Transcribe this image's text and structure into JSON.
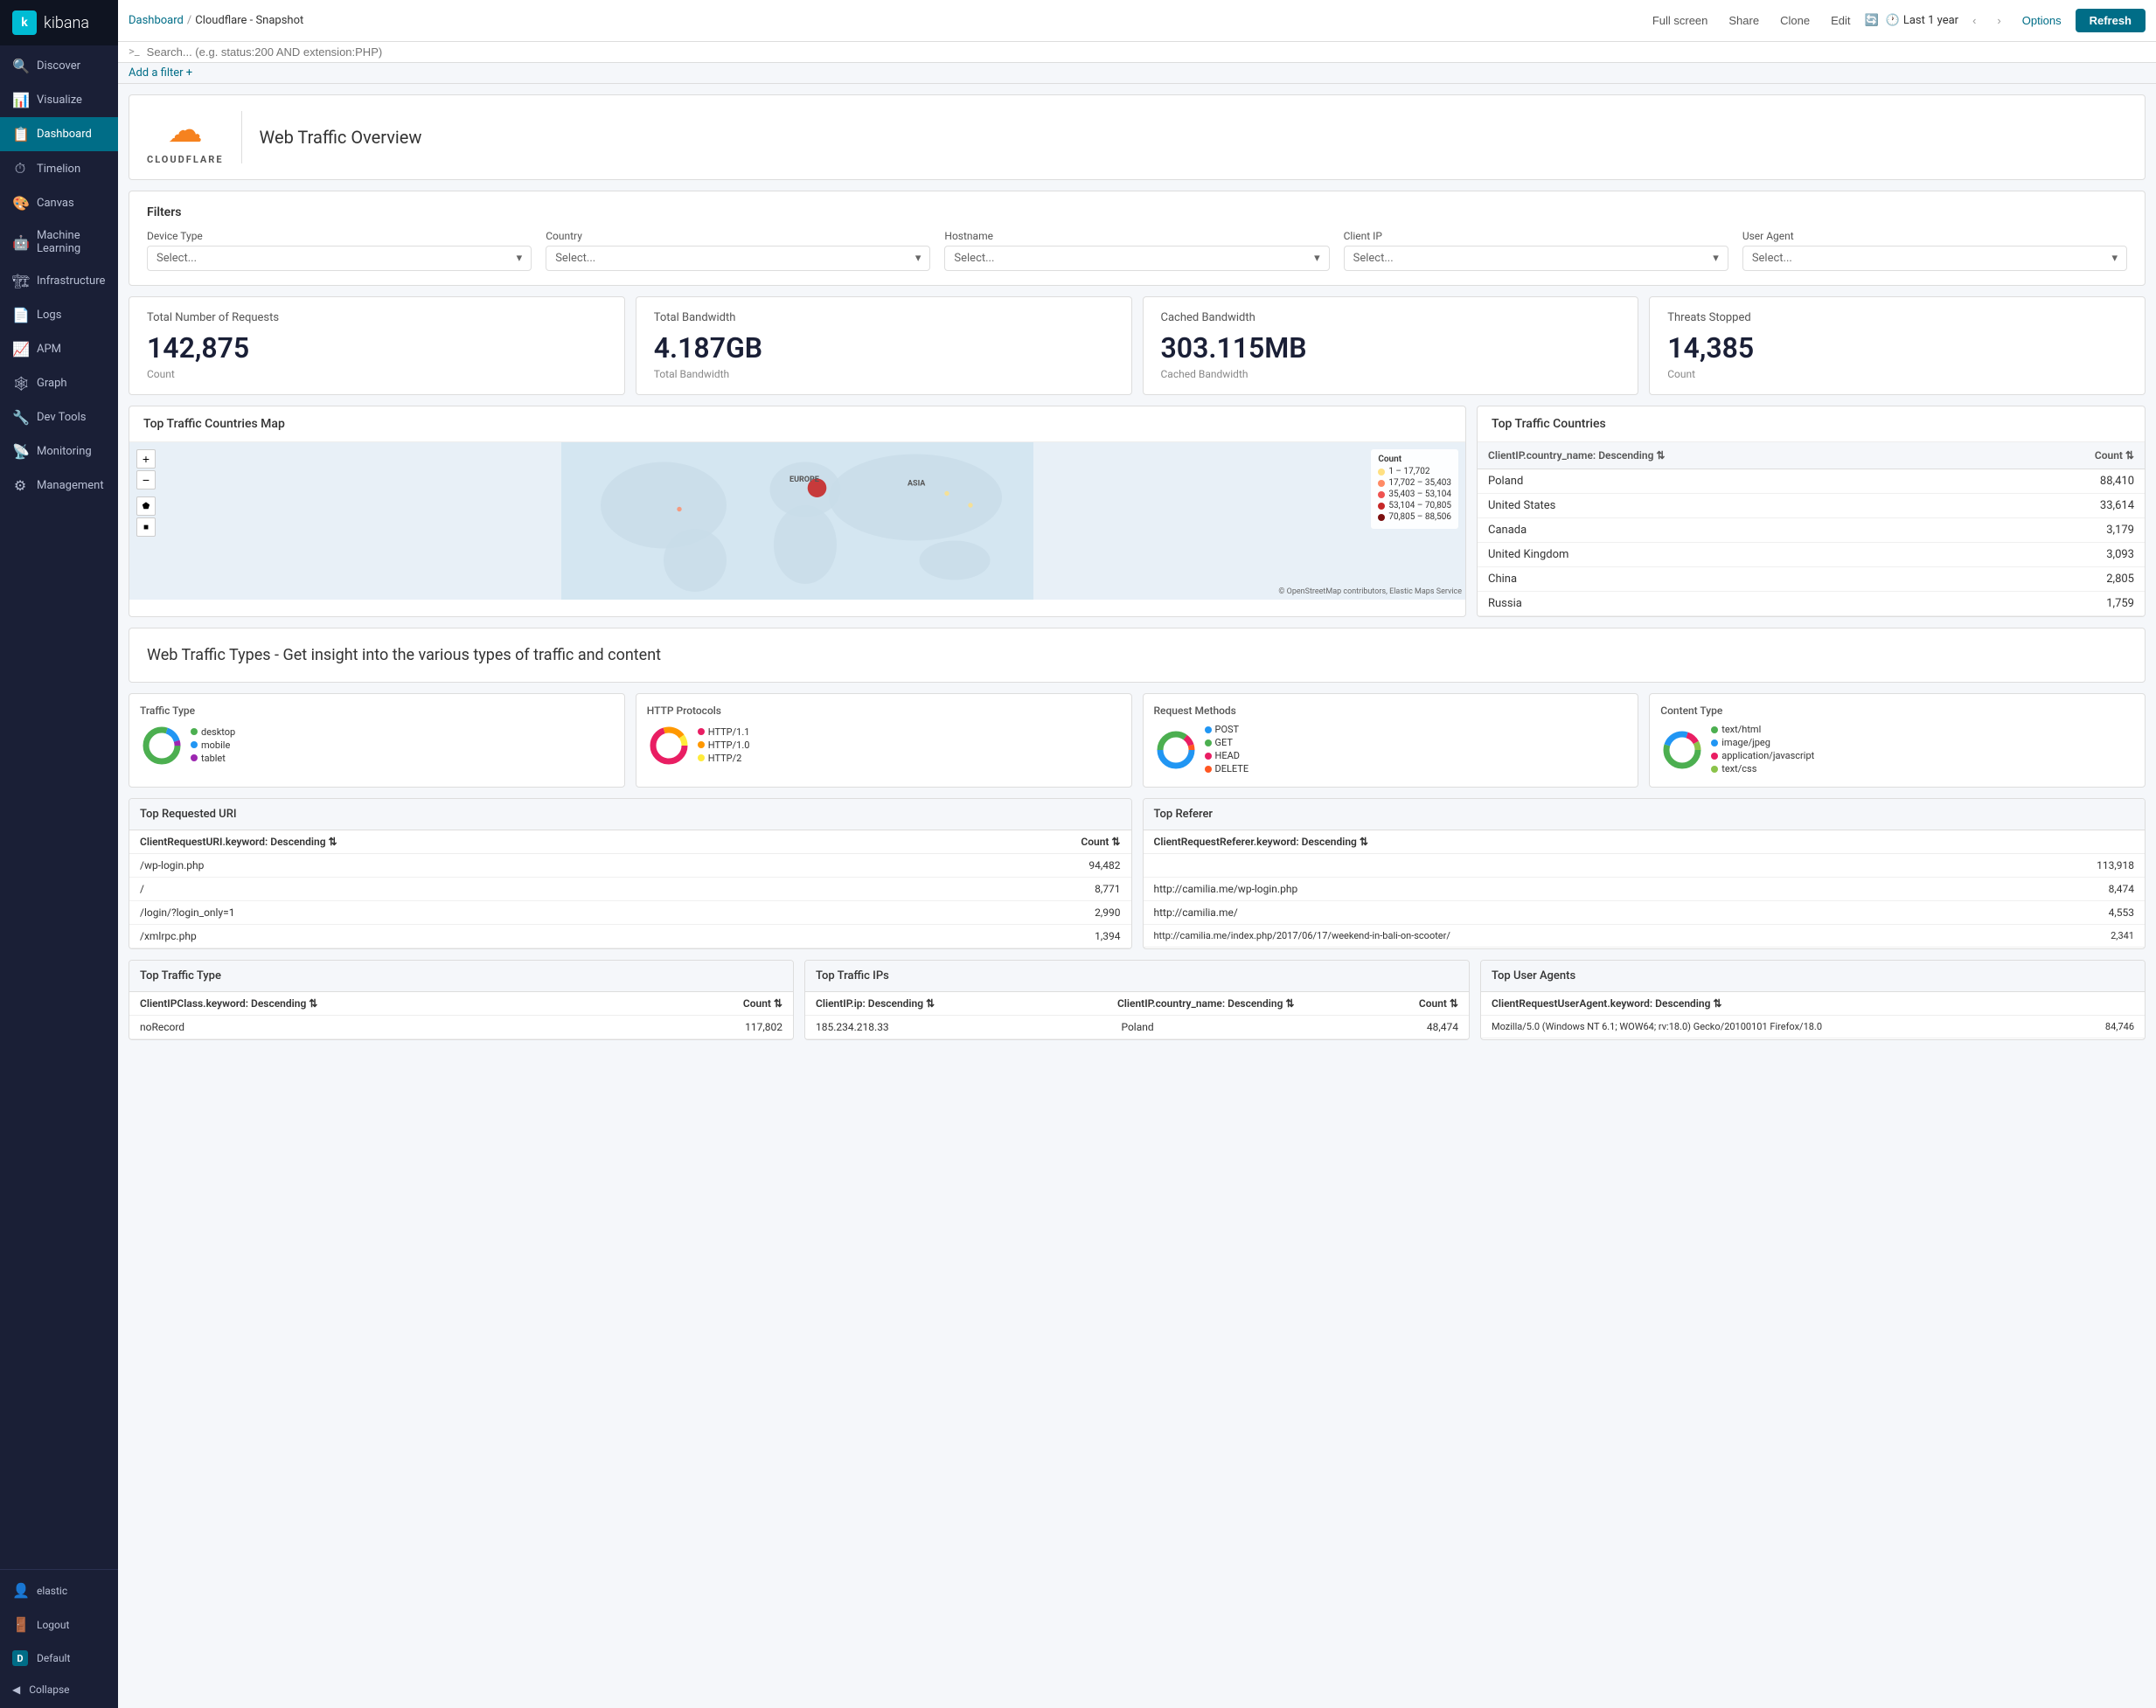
{
  "sidebar": {
    "logo": "kibana",
    "items": [
      {
        "id": "discover",
        "label": "Discover",
        "icon": "🔍"
      },
      {
        "id": "visualize",
        "label": "Visualize",
        "icon": "📊"
      },
      {
        "id": "dashboard",
        "label": "Dashboard",
        "icon": "📋",
        "active": true
      },
      {
        "id": "timelion",
        "label": "Timelion",
        "icon": "⏱"
      },
      {
        "id": "canvas",
        "label": "Canvas",
        "icon": "🎨"
      },
      {
        "id": "machine-learning",
        "label": "Machine Learning",
        "icon": "🤖"
      },
      {
        "id": "infrastructure",
        "label": "Infrastructure",
        "icon": "🏗"
      },
      {
        "id": "logs",
        "label": "Logs",
        "icon": "📄"
      },
      {
        "id": "apm",
        "label": "APM",
        "icon": "📈"
      },
      {
        "id": "graph",
        "label": "Graph",
        "icon": "🕸"
      },
      {
        "id": "dev-tools",
        "label": "Dev Tools",
        "icon": "🔧"
      },
      {
        "id": "monitoring",
        "label": "Monitoring",
        "icon": "📡"
      },
      {
        "id": "management",
        "label": "Management",
        "icon": "⚙"
      }
    ],
    "bottom": [
      {
        "id": "elastic",
        "label": "elastic",
        "icon": "👤"
      },
      {
        "id": "logout",
        "label": "Logout",
        "icon": "🚪"
      },
      {
        "id": "default",
        "label": "Default",
        "icon": "D"
      }
    ],
    "collapse_label": "Collapse"
  },
  "topbar": {
    "breadcrumb_home": "Dashboard",
    "breadcrumb_sep": "/",
    "breadcrumb_current": "Cloudflare - Snapshot",
    "actions": [
      "Full screen",
      "Share",
      "Clone",
      "Edit"
    ],
    "auto_refresh": "Auto-refresh",
    "time_label": "Last 1 year",
    "options_label": "Options",
    "refresh_label": "Refresh"
  },
  "searchbar": {
    "prompt": ">_",
    "placeholder": "Search... (e.g. status:200 AND extension:PHP)"
  },
  "filterbar": {
    "add_filter": "Add a filter +"
  },
  "overview": {
    "logo_text": "CLOUDFLARE",
    "title": "Web Traffic Overview"
  },
  "filters": {
    "title": "Filters",
    "fields": [
      {
        "label": "Device Type",
        "placeholder": "Select..."
      },
      {
        "label": "Country",
        "placeholder": "Select..."
      },
      {
        "label": "Hostname",
        "placeholder": "Select..."
      },
      {
        "label": "Client IP",
        "placeholder": "Select..."
      },
      {
        "label": "User Agent",
        "placeholder": "Select..."
      }
    ]
  },
  "metrics": [
    {
      "label": "Total Number of Requests",
      "value": "142,875",
      "sublabel": "Count"
    },
    {
      "label": "Total Bandwidth",
      "value": "4.187GB",
      "sublabel": "Total Bandwidth"
    },
    {
      "label": "Cached Bandwidth",
      "value": "303.115MB",
      "sublabel": "Cached Bandwidth"
    },
    {
      "label": "Threats Stopped",
      "value": "14,385",
      "sublabel": "Count"
    }
  ],
  "map": {
    "title": "Top Traffic Countries Map",
    "legend_title": "Count",
    "legend_items": [
      {
        "range": "1 – 17,702",
        "color": "#ffe082"
      },
      {
        "range": "17,702 – 35,403",
        "color": "#ff8a65"
      },
      {
        "range": "35,403 – 53,104",
        "color": "#ef5350"
      },
      {
        "range": "53,104 – 70,805",
        "color": "#c62828"
      },
      {
        "range": "70,805 – 88,506",
        "color": "#7b1010"
      }
    ],
    "credit": "© OpenStreetMap contributors, Elastic Maps Service",
    "labels": [
      "EUROPE",
      "ASIA"
    ]
  },
  "top_countries": {
    "title": "Top Traffic Countries",
    "col_header": "ClientIP.country_name: Descending",
    "col_count": "Count",
    "rows": [
      {
        "country": "Poland",
        "count": "88,410"
      },
      {
        "country": "United States",
        "count": "33,614"
      },
      {
        "country": "Canada",
        "count": "3,179"
      },
      {
        "country": "United Kingdom",
        "count": "3,093"
      },
      {
        "country": "China",
        "count": "2,805"
      },
      {
        "country": "Russia",
        "count": "1,759"
      }
    ]
  },
  "traffic_types_section": {
    "title": "Web Traffic Types - Get insight into the various types of traffic and content"
  },
  "donuts": [
    {
      "label": "Traffic Type",
      "segments": [
        {
          "label": "desktop",
          "color": "#4caf50",
          "pct": 80
        },
        {
          "label": "mobile",
          "color": "#2196f3",
          "pct": 15
        },
        {
          "label": "tablet",
          "color": "#9c27b0",
          "pct": 5
        }
      ]
    },
    {
      "label": "HTTP Protocols",
      "segments": [
        {
          "label": "HTTP/1.1",
          "color": "#e91e63",
          "pct": 70
        },
        {
          "label": "HTTP/1.0",
          "color": "#ff9800",
          "pct": 20
        },
        {
          "label": "HTTP/2",
          "color": "#ffeb3b",
          "pct": 10
        }
      ]
    },
    {
      "label": "Request Methods",
      "segments": [
        {
          "label": "POST",
          "color": "#2196f3",
          "pct": 50
        },
        {
          "label": "GET",
          "color": "#4caf50",
          "pct": 35
        },
        {
          "label": "HEAD",
          "color": "#e91e63",
          "pct": 10
        },
        {
          "label": "DELETE",
          "color": "#ff5722",
          "pct": 5
        }
      ]
    },
    {
      "label": "Content Type",
      "segments": [
        {
          "label": "text/html",
          "color": "#4caf50",
          "pct": 55
        },
        {
          "label": "image/jpeg",
          "color": "#2196f3",
          "pct": 25
        },
        {
          "label": "application/javascript",
          "color": "#e91e63",
          "pct": 12
        },
        {
          "label": "text/css",
          "color": "#4caf50",
          "pct": 8
        }
      ]
    }
  ],
  "top_requested_uri": {
    "title": "Top Requested URI",
    "col1": "ClientRequestURI.keyword: Descending",
    "col2": "Count",
    "rows": [
      {
        "uri": "/wp-login.php",
        "count": "94,482"
      },
      {
        "uri": "/",
        "count": "8,771"
      },
      {
        "uri": "/login/?login_only=1",
        "count": "2,990"
      },
      {
        "uri": "/xmlrpc.php",
        "count": "1,394"
      }
    ]
  },
  "top_referer": {
    "title": "Top Referer",
    "col1": "ClientRequestReferer.keyword: Descending",
    "col2": "",
    "rows": [
      {
        "url": "",
        "count": "113,918"
      },
      {
        "url": "http://camilia.me/wp-login.php",
        "count": "8,474"
      },
      {
        "url": "http://camilia.me/",
        "count": "4,553"
      },
      {
        "url": "http://camilia.me/index.php/2017/06/17/weekend-in-bali-on-scooter/",
        "count": "2,341"
      }
    ]
  },
  "top_traffic_type": {
    "title": "Top Traffic Type",
    "col1": "ClientIPClass.keyword: Descending",
    "col2": "Count",
    "rows": [
      {
        "type": "noRecord",
        "count": "117,802"
      }
    ]
  },
  "top_traffic_ips": {
    "title": "Top Traffic IPs",
    "col1": "ClientIP.ip: Descending",
    "col2": "ClientIP.country_name: Descending",
    "col3": "Count",
    "rows": [
      {
        "ip": "185.234.218.33",
        "country": "Poland",
        "count": "48,474"
      }
    ]
  },
  "top_user_agents": {
    "title": "Top User Agents",
    "col1": "ClientRequestUserAgent.keyword: Descending",
    "rows": [
      {
        "agent": "Mozilla/5.0 (Windows NT 6.1; WOW64; rv:18.0) Gecko/20100101 Firefox/18.0",
        "count": "84,746"
      }
    ]
  }
}
